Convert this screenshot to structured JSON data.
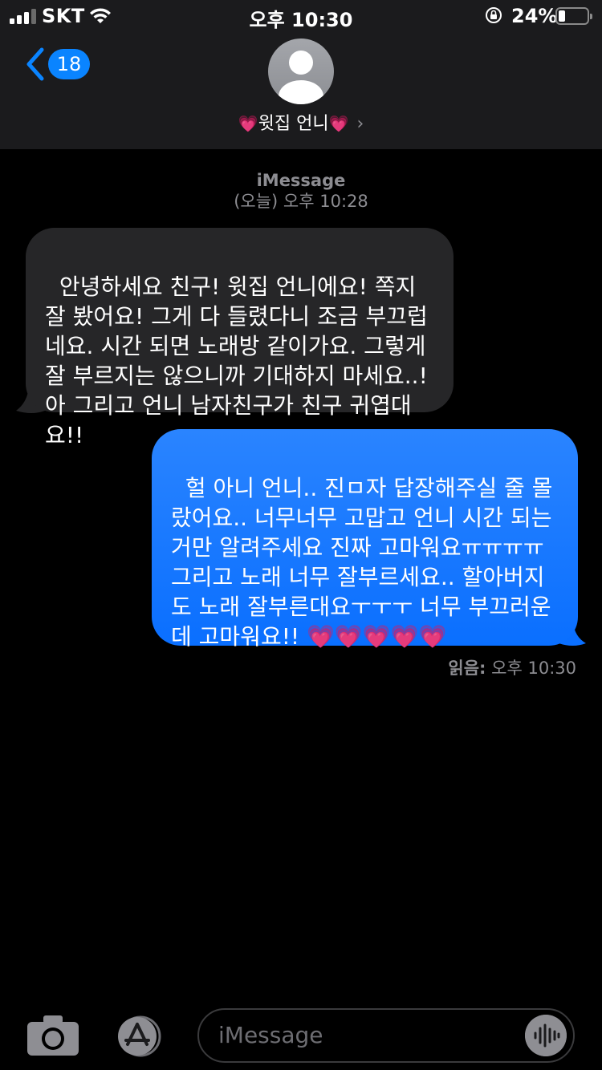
{
  "status_bar": {
    "carrier": "SKT",
    "time": "오후 10:30",
    "battery_percent": "24%",
    "battery_level": 0.24
  },
  "nav": {
    "back_badge": "18",
    "contact_name": "💗윗집 언니💗",
    "contact_heart_left": "💗",
    "contact_name_text": "윗집 언니",
    "contact_heart_right": "💗",
    "chevron": "›"
  },
  "conversation": {
    "service": "iMessage",
    "date": "(오늘) 오후 10:28"
  },
  "messages": [
    {
      "direction": "incoming",
      "text": "안녕하세요 친구! 윗집 언니에요! 쪽지 잘 봤어요! 그게 다 들렸다니 조금 부끄럽네요. 시간 되면 노래방 같이가요. 그렇게 잘 부르지는 않으니까 기대하지 마세요..! 아 그리고 언니 남자친구가 친구 귀엽대요!!"
    },
    {
      "direction": "outgoing",
      "text": "헐 아니 언니.. 진ㅁ자 답장해주실 줄 몰랐어요.. 너무너무 고맙고 언니 시간 되는거만 알려주세요 진짜 고마워요ㅠㅠㅠㅠ 그리고 노래 너무 잘부르세요.. 할아버지도 노래 잘부른대요ㅜㅜㅜ 너무 부끄러운데 고마워요!!",
      "hearts": "💗💗💗💗💗"
    }
  ],
  "receipt": {
    "label": "읽음:",
    "time": "오후 10:30"
  },
  "compose": {
    "placeholder": "iMessage"
  },
  "icons": {
    "back": "chevron-left-icon",
    "camera": "camera-icon",
    "apps": "app-store-icon",
    "audio": "audio-waveform-icon",
    "orientation_lock": "orientation-lock-icon",
    "wifi": "wifi-icon",
    "signal": "cellular-signal-icon",
    "battery": "battery-icon"
  },
  "colors": {
    "outgoing_bubble": "#1a7cff",
    "incoming_bubble": "#262628",
    "header_bg": "#1b1b1d",
    "badge": "#0a84ff",
    "secondary_text": "#8d8d92",
    "heart": "#ff4fa3"
  }
}
